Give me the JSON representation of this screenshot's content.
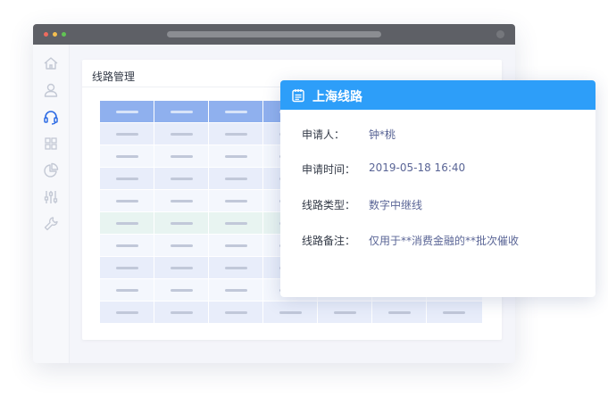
{
  "window": {
    "controls": [
      "close",
      "minimize",
      "maximize"
    ]
  },
  "sidebar": {
    "items": [
      {
        "icon": "home-icon",
        "active": false
      },
      {
        "icon": "user-icon",
        "active": false
      },
      {
        "icon": "headset-icon",
        "active": true
      },
      {
        "icon": "grid-icon",
        "active": false
      },
      {
        "icon": "pie-chart-icon",
        "active": false
      },
      {
        "icon": "sliders-icon",
        "active": false
      },
      {
        "icon": "wrench-icon",
        "active": false
      }
    ],
    "active_color": "#2d6be4",
    "icon_color": "#c3c8d4"
  },
  "panel": {
    "title": "线路管理"
  },
  "detail_card": {
    "title": "上海线路",
    "header_color": "#2d9ef9",
    "icon": "notepad-icon",
    "fields": [
      {
        "label": "申请人：",
        "value": "钟*桃"
      },
      {
        "label": "申请时间：",
        "value": "2019-05-18 16:40"
      },
      {
        "label": "线路类型：",
        "value": "数字中继线"
      },
      {
        "label": "线路备注：",
        "value": "仅用于**消费金融的**批次催收"
      }
    ]
  }
}
